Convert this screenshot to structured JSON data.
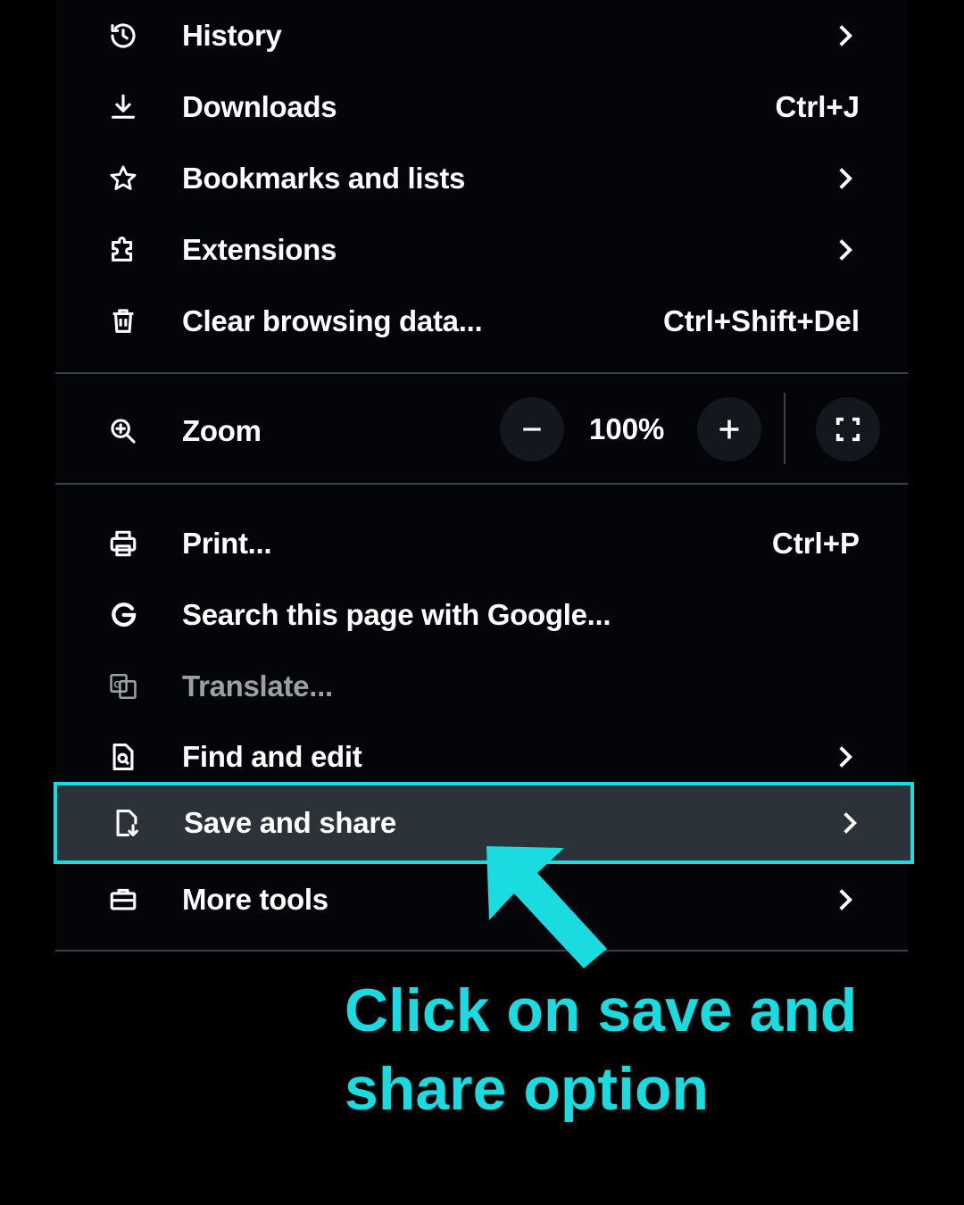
{
  "menu": {
    "items_top": [
      {
        "label": "History",
        "icon": "history-icon",
        "shortcut": "",
        "submenu": true
      },
      {
        "label": "Downloads",
        "icon": "download-icon",
        "shortcut": "Ctrl+J",
        "submenu": false
      },
      {
        "label": "Bookmarks and lists",
        "icon": "star-icon",
        "shortcut": "",
        "submenu": true
      },
      {
        "label": "Extensions",
        "icon": "puzzle-icon",
        "shortcut": "",
        "submenu": true
      },
      {
        "label": "Clear browsing data...",
        "icon": "trash-icon",
        "shortcut": "Ctrl+Shift+Del",
        "submenu": false
      }
    ],
    "zoom": {
      "label": "Zoom",
      "value": "100%",
      "minus": "−",
      "plus": "+"
    },
    "items_bottom": [
      {
        "label": "Print...",
        "icon": "printer-icon",
        "shortcut": "Ctrl+P",
        "submenu": false
      },
      {
        "label": "Search this page with Google...",
        "icon": "google-icon",
        "shortcut": "",
        "submenu": false
      },
      {
        "label": "Translate...",
        "icon": "translate-icon",
        "shortcut": "",
        "submenu": false,
        "disabled": true
      },
      {
        "label": "Find and edit",
        "icon": "find-page-icon",
        "shortcut": "",
        "submenu": true
      },
      {
        "label": "Save and share",
        "icon": "save-share-icon",
        "shortcut": "",
        "submenu": true,
        "highlighted": true
      },
      {
        "label": "More tools",
        "icon": "toolbox-icon",
        "shortcut": "",
        "submenu": true
      }
    ]
  },
  "annotation": {
    "caption": "Click on save and share option",
    "color": "#19dbe0"
  },
  "colors": {
    "background": "#000000",
    "menu_bg": "#040509",
    "highlight_bg": "#2b3338",
    "accent": "#19dbe0",
    "text": "#ffffff",
    "disabled_text": "#9aa0a6"
  }
}
